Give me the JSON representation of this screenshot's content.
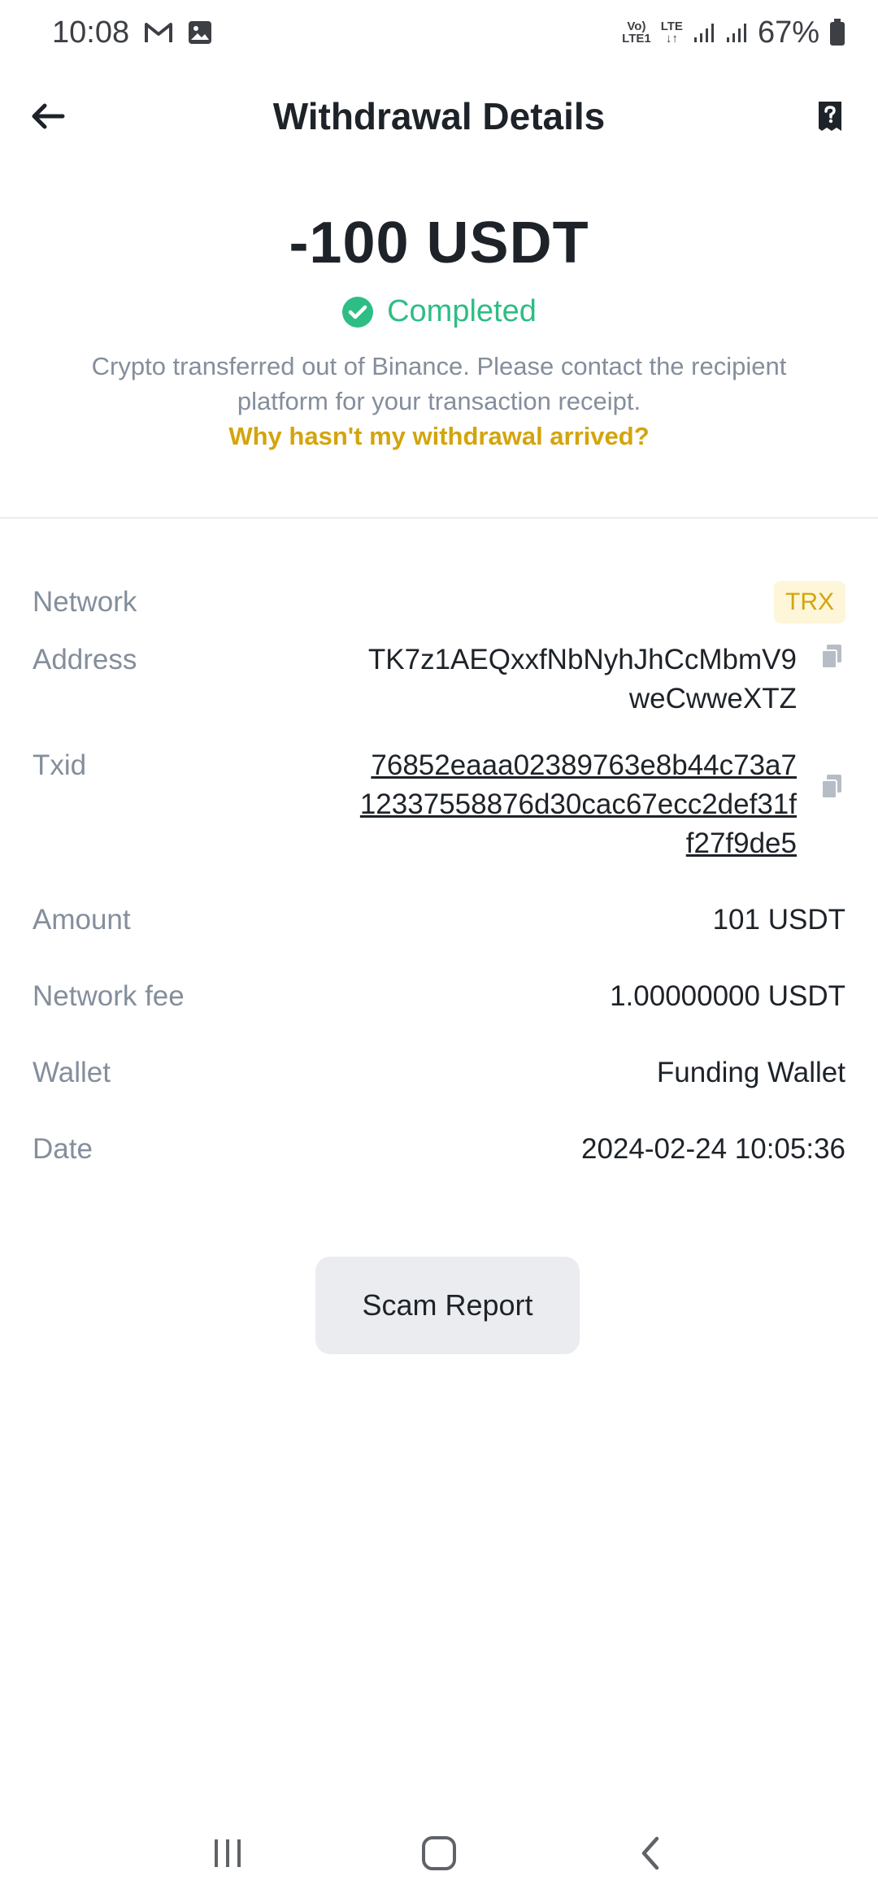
{
  "status_bar": {
    "time": "10:08",
    "network_top": "Vo)",
    "network_bottom": "LTE1",
    "lte_label": "LTE",
    "battery": "67%",
    "icons": [
      "gmail-icon",
      "gallery-icon",
      "signal-icon",
      "signal-icon",
      "battery-icon"
    ]
  },
  "header": {
    "title": "Withdrawal Details",
    "back_icon": "arrow-left-icon",
    "receipt_icon": "question-document-icon"
  },
  "summary": {
    "amount": "-100 USDT",
    "status": "Completed",
    "status_color": "#2ebd85",
    "description": "Crypto transferred out of Binance. Please contact the recipient platform for your transaction receipt.",
    "help_link": "Why hasn't my withdrawal arrived?"
  },
  "details": {
    "network": {
      "label": "Network",
      "value": "TRX"
    },
    "address": {
      "label": "Address",
      "value": "TK7z1AEQxxfNbNyhJhCcMbmV9weCwweXTZ"
    },
    "txid": {
      "label": "Txid",
      "value": "76852eaaa02389763e8b44c73a712337558876d30cac67ecc2def31ff27f9de5"
    },
    "amount": {
      "label": "Amount",
      "value": "101 USDT"
    },
    "network_fee": {
      "label": "Network fee",
      "value": "1.00000000 USDT"
    },
    "wallet": {
      "label": "Wallet",
      "value": "Funding Wallet"
    },
    "date": {
      "label": "Date",
      "value": "2024-02-24 10:05:36"
    }
  },
  "actions": {
    "scam_report": "Scam Report"
  },
  "colors": {
    "accent": "#d4a40c",
    "success": "#2ebd85",
    "muted_text": "#848e9c",
    "primary_text": "#1e2329"
  }
}
